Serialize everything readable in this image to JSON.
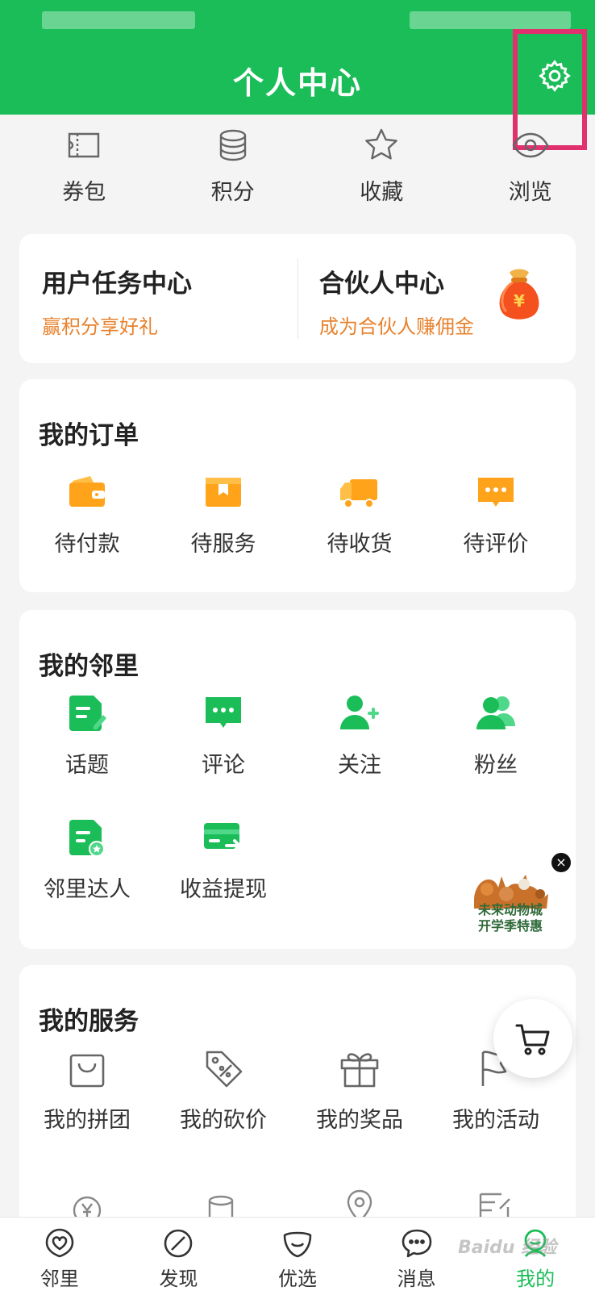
{
  "header": {
    "title": "个人中心",
    "settings_icon": "gear-icon"
  },
  "quick_links": [
    {
      "label": "券包",
      "icon": "ticket-icon"
    },
    {
      "label": "积分",
      "icon": "coins-icon"
    },
    {
      "label": "收藏",
      "icon": "star-icon"
    },
    {
      "label": "浏览",
      "icon": "eye-icon"
    }
  ],
  "task_card": {
    "left": {
      "title": "用户任务中心",
      "subtitle": "赢积分享好礼"
    },
    "right": {
      "title": "合伙人中心",
      "subtitle": "成为合伙人赚佣金"
    }
  },
  "orders": {
    "title": "我的订单",
    "items": [
      {
        "label": "待付款",
        "icon": "wallet-icon"
      },
      {
        "label": "待服务",
        "icon": "package-icon"
      },
      {
        "label": "待收货",
        "icon": "truck-icon"
      },
      {
        "label": "待评价",
        "icon": "comment-icon"
      }
    ]
  },
  "neighbors": {
    "title": "我的邻里",
    "items": [
      {
        "label": "话题",
        "icon": "topic-icon"
      },
      {
        "label": "评论",
        "icon": "chat-icon"
      },
      {
        "label": "关注",
        "icon": "add-user-icon"
      },
      {
        "label": "粉丝",
        "icon": "users-icon"
      },
      {
        "label": "邻里达人",
        "icon": "badge-doc-icon"
      },
      {
        "label": "收益提现",
        "icon": "card-transfer-icon"
      }
    ]
  },
  "ad": {
    "text_line1": "未来动物城",
    "text_line2": "开学季特惠",
    "close": "×"
  },
  "services": {
    "title": "我的服务",
    "items": [
      {
        "label": "我的拼团",
        "icon": "bag-icon"
      },
      {
        "label": "我的砍价",
        "icon": "discount-tag-icon"
      },
      {
        "label": "我的奖品",
        "icon": "gift-icon"
      },
      {
        "label": "我的活动",
        "icon": "flag-icon"
      }
    ]
  },
  "tabbar": [
    {
      "label": "邻里",
      "icon": "heart-bubble-icon",
      "active": false
    },
    {
      "label": "发现",
      "icon": "compass-icon",
      "active": false
    },
    {
      "label": "优选",
      "icon": "smile-icon",
      "active": false
    },
    {
      "label": "消息",
      "icon": "message-icon",
      "active": false
    },
    {
      "label": "我的",
      "icon": "person-icon",
      "active": true
    }
  ],
  "watermark": "Baidu 经验",
  "colors": {
    "brand_green": "#1bbd58",
    "order_orange": "#ffa31a",
    "subtitle_orange": "#e8822d",
    "highlight": "#e0306e"
  }
}
